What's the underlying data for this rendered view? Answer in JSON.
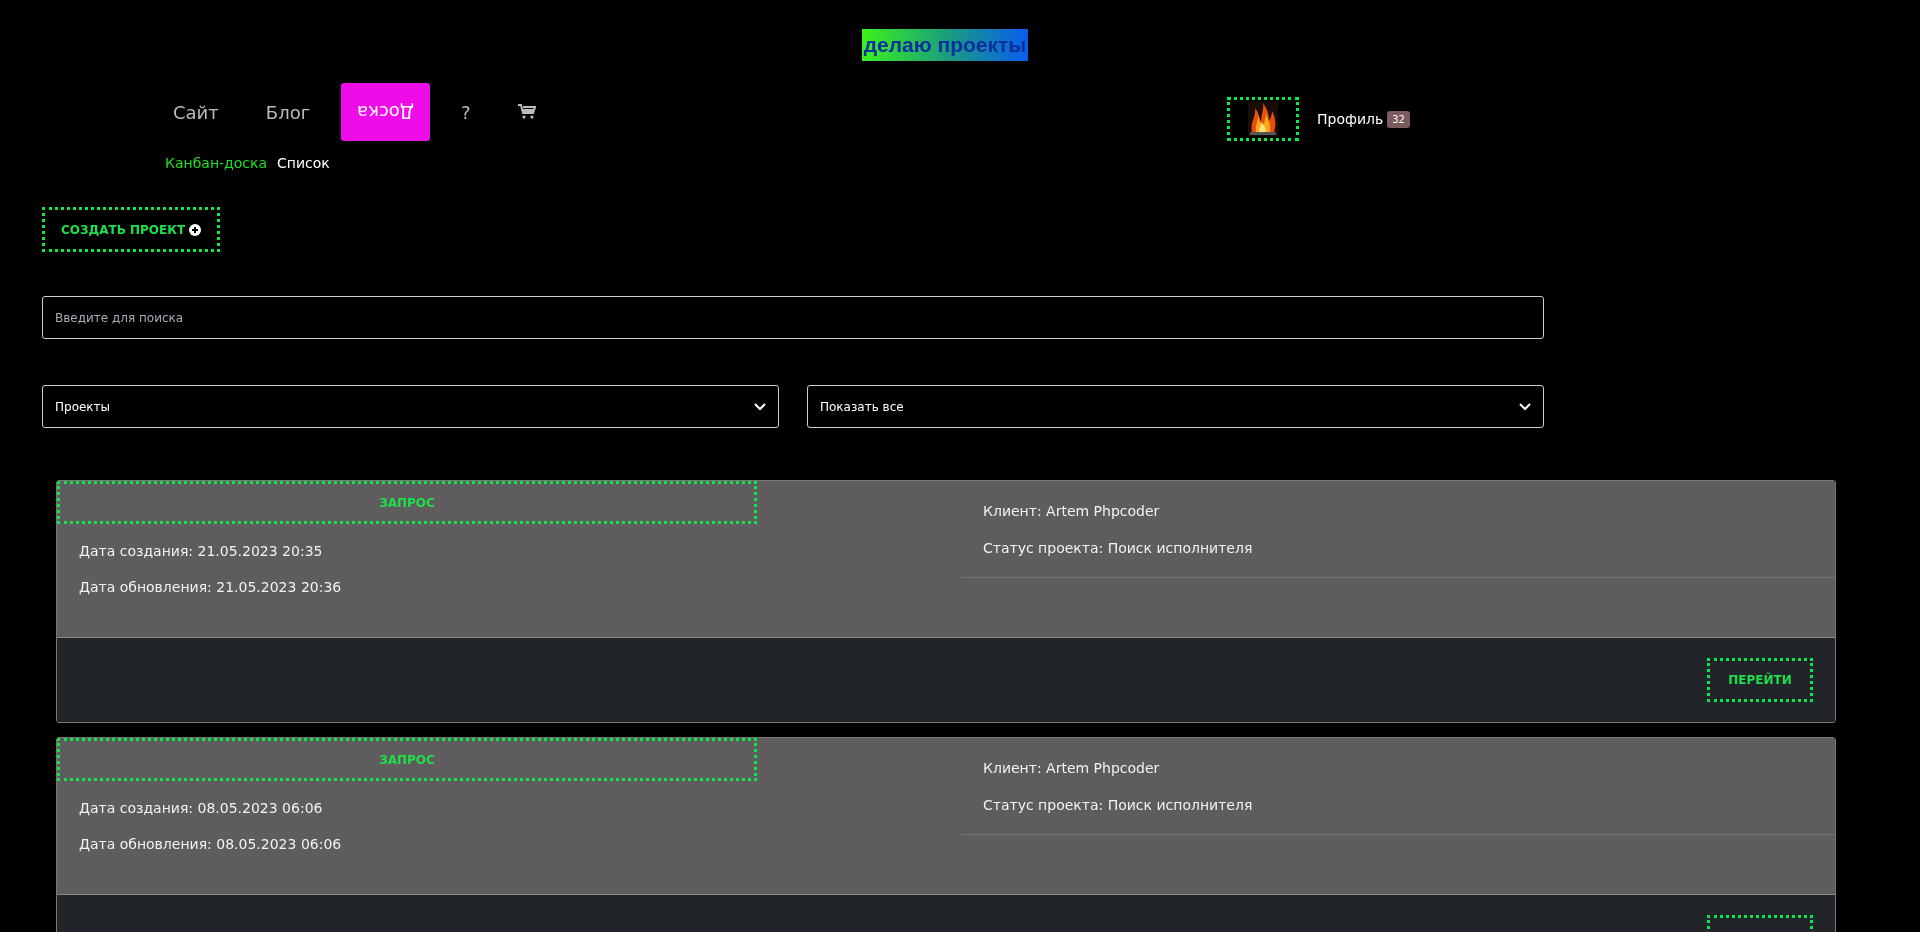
{
  "logo": "делаю проекты",
  "nav": [
    {
      "label": "Сайт",
      "kind": "text",
      "selected": false
    },
    {
      "label": "Блог",
      "kind": "text",
      "selected": false
    },
    {
      "label": "Доска",
      "kind": "text",
      "selected": true
    },
    {
      "label": "?",
      "kind": "text",
      "selected": false
    },
    {
      "kind": "cart",
      "selected": false
    }
  ],
  "subnav": [
    {
      "label": "Канбан-доска",
      "selected": true
    },
    {
      "label": "Список",
      "selected": false
    }
  ],
  "profile": {
    "label": "Профиль",
    "badge": "32"
  },
  "create_button": "СОЗДАТЬ ПРОЕКТ",
  "search": {
    "placeholder": "Введите для поиска"
  },
  "filters": [
    {
      "value": "Проекты"
    },
    {
      "value": "Показать все"
    }
  ],
  "cards": [
    {
      "status": "ЗАПРОС",
      "created": "Дата создания: 21.05.2023 20:35",
      "updated": "Дата обновления: 21.05.2023 20:36",
      "client": "Клиент: Artem Phpcoder",
      "project_status": "Статус проекта: Поиск исполнителя",
      "action": "ПЕРЕЙТИ"
    },
    {
      "status": "ЗАПРОС",
      "created": "Дата создания: 08.05.2023 06:06",
      "updated": "Дата обновления: 08.05.2023 06:06",
      "client": "Клиент: Artem Phpcoder",
      "project_status": "Статус проекта: Поиск исполнителя"
    }
  ]
}
